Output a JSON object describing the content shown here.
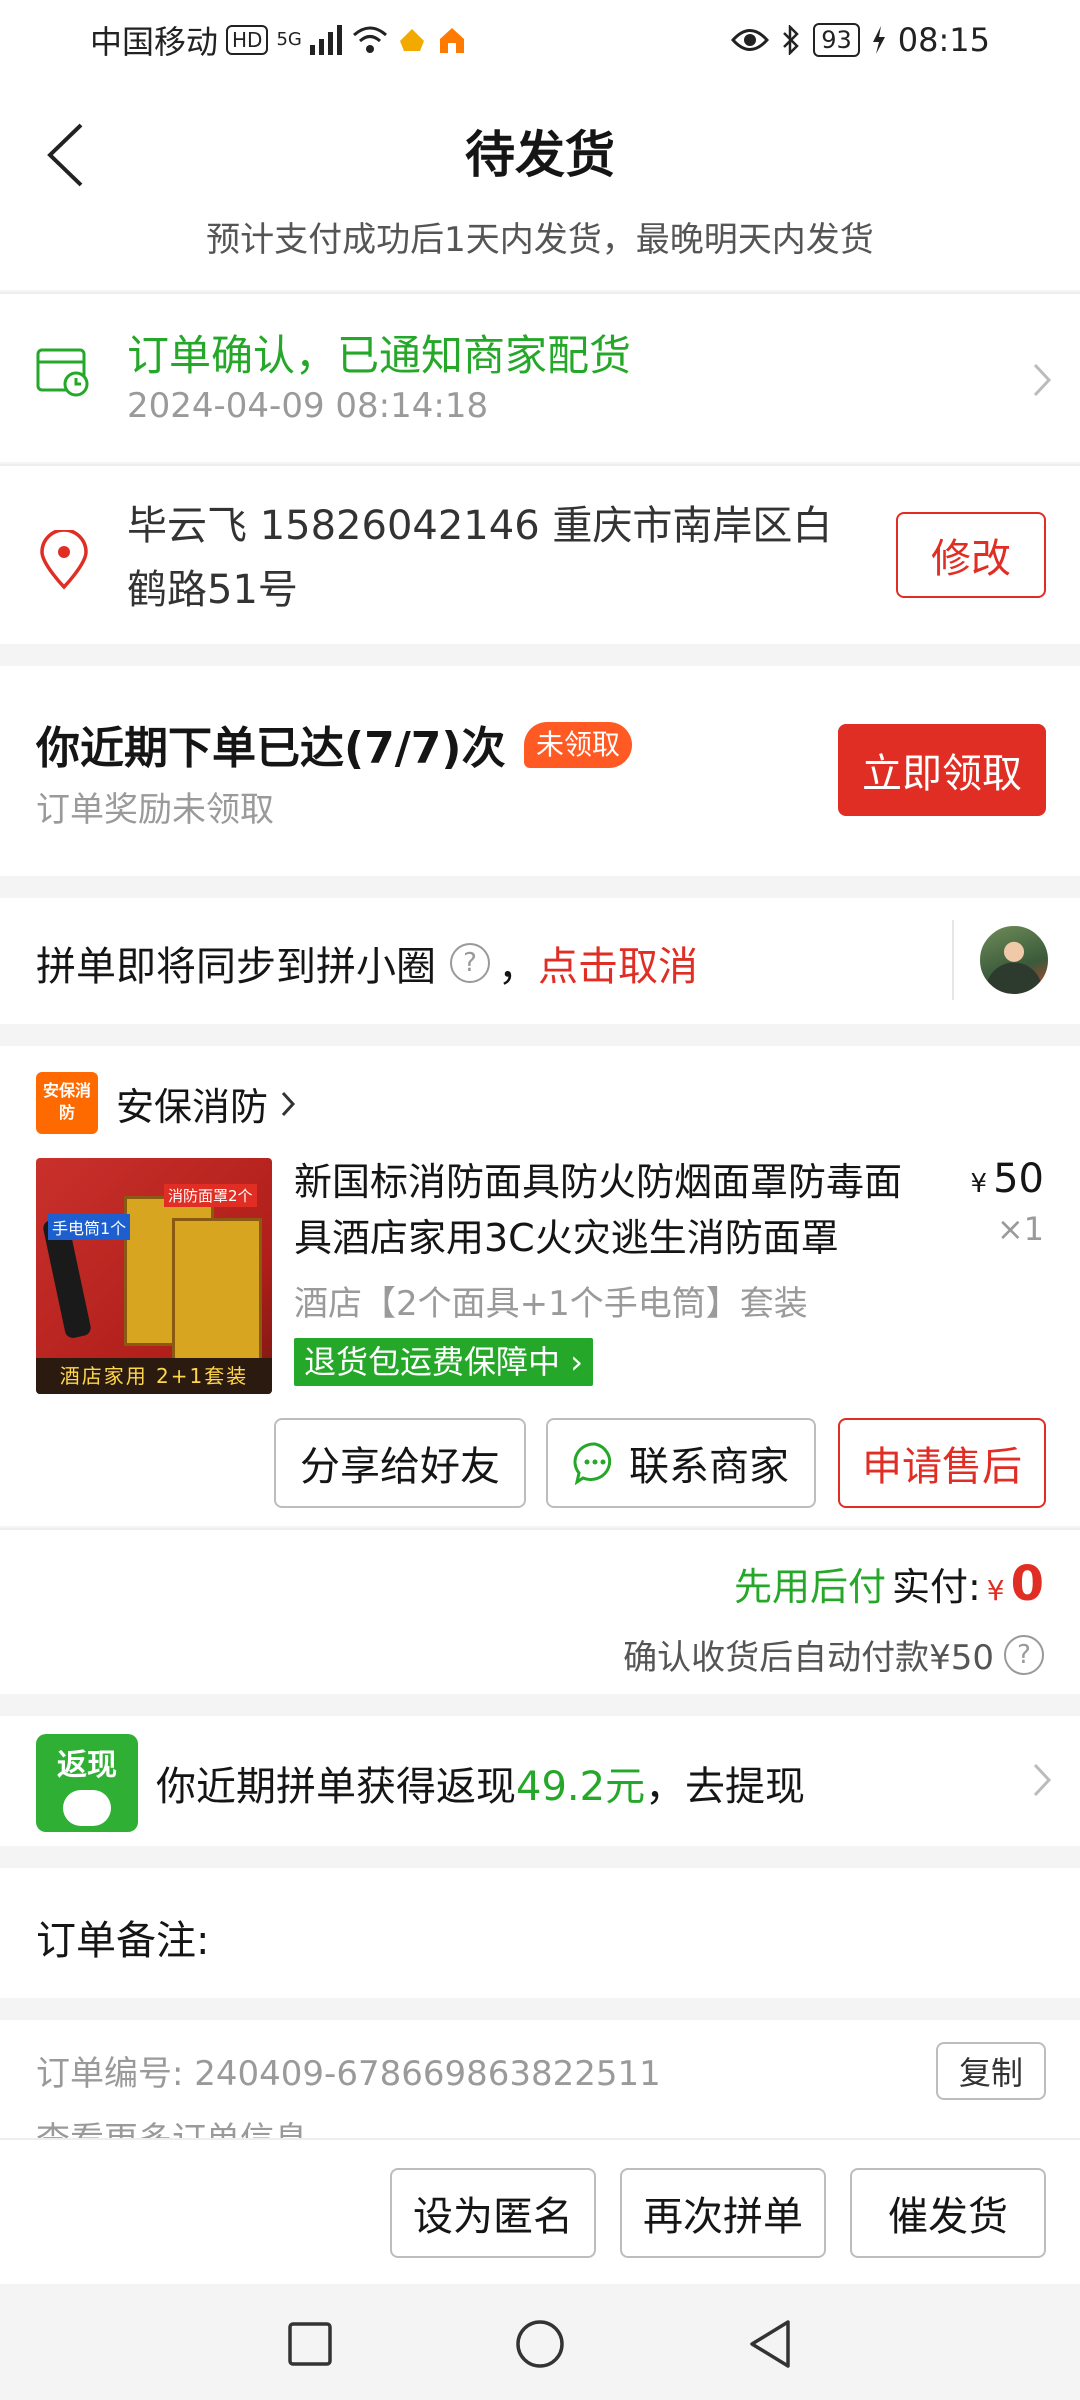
{
  "status_bar": {
    "carrier": "中国移动",
    "hd_badge": "HD",
    "network": "5G",
    "battery": "93",
    "time": "08:15"
  },
  "header": {
    "title": "待发货",
    "subtitle": "预计支付成功后1天内发货，最晚明天内发货"
  },
  "order_status": {
    "title": "订单确认，已通知商家配货",
    "time": "2024-04-09 08:14:18"
  },
  "address": {
    "text": "毕云飞  15826042146  重庆市南岸区白鹤路51号",
    "edit_label": "修改"
  },
  "reward": {
    "title": "你近期下单已达(7/7)次",
    "badge": "未领取",
    "subtitle": "订单奖励未领取",
    "button": "立即领取"
  },
  "sync": {
    "text": "拼单即将同步到拼小圈",
    "help": "?",
    "separator": "，",
    "cancel": "点击取消"
  },
  "product": {
    "shop_logo": "安保消防",
    "shop_name": "安保消防",
    "title": "新国标消防面具防火防烟面罩防毒面具酒店家用3C火灾逃生消防面罩",
    "price_symbol": "¥",
    "price": "50",
    "quantity": "×1",
    "spec": "酒店【2个面具+1个手电筒】套装",
    "guarantee": "退货包运费保障中",
    "image": {
      "tag_torch": "手电筒1个",
      "tag_mask": "消防面罩2个",
      "footer": "酒店家用  2+1套装"
    },
    "actions": {
      "share": "分享给好友",
      "contact": "联系商家",
      "aftersale": "申请售后"
    }
  },
  "payment": {
    "green_label": "先用后付",
    "actual_label": "实付:",
    "yen": "¥",
    "amount": "0",
    "auto_note": "确认收货后自动付款¥50",
    "help": "?"
  },
  "cashback": {
    "icon_label": "返现",
    "text_prefix": "你近期拼单获得返现",
    "amount": "49.2元",
    "text_suffix": "，去提现"
  },
  "note": {
    "label": "订单备注:"
  },
  "order_info": {
    "order_no": "订单编号:  240409-678669863822511",
    "copy": "复制",
    "more": "查看更多订单信息"
  },
  "bottom_actions": {
    "anonymous": "设为匿名",
    "regroup": "再次拼单",
    "urge": "催发货"
  },
  "colors": {
    "accent_red": "#e02e24",
    "accent_green": "#25a829",
    "badge_orange": "#ff5a24"
  }
}
